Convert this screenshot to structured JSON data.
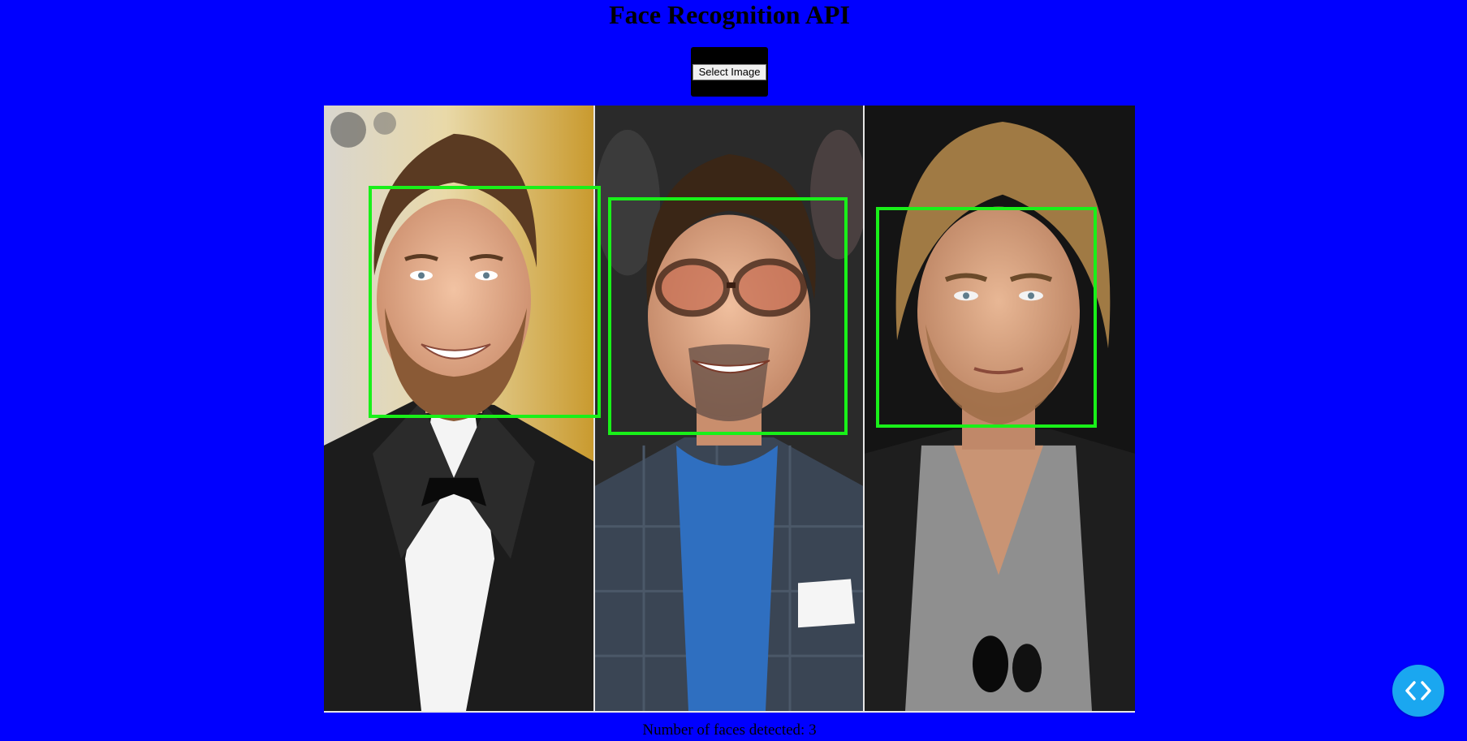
{
  "page": {
    "title": "Face Recognition API",
    "background_color": "#0000ff"
  },
  "upload": {
    "button_label": "Select Image"
  },
  "result": {
    "faces_detected": 3,
    "status_text": "Number of faces detected: 3",
    "box_color": "#19f019"
  },
  "fab": {
    "icon": "code-icon",
    "color": "#1aa7f0"
  }
}
